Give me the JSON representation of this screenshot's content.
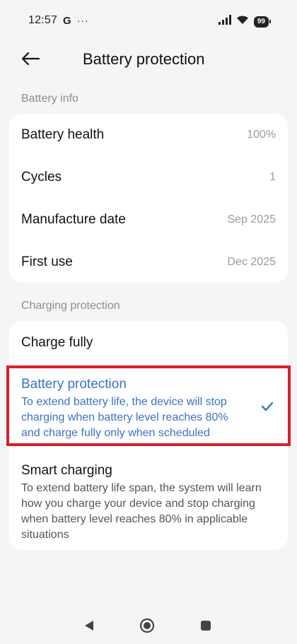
{
  "status_bar": {
    "time": "12:57",
    "google_indicator": "G",
    "more_notifications": "···",
    "battery_level": "99"
  },
  "header": {
    "title": "Battery protection"
  },
  "battery_info": {
    "section_label": "Battery info",
    "rows": [
      {
        "label": "Battery health",
        "value": "100%"
      },
      {
        "label": "Cycles",
        "value": "1"
      },
      {
        "label": "Manufacture date",
        "value": "Sep 2025"
      },
      {
        "label": "First use",
        "value": "Dec 2025"
      }
    ]
  },
  "charging_protection": {
    "section_label": "Charging protection",
    "options": [
      {
        "title": "Charge fully",
        "description": "",
        "selected": false
      },
      {
        "title": "Battery protection",
        "description": "To extend battery life, the device will stop charging when battery level reaches 80% and charge fully only when scheduled",
        "selected": true
      },
      {
        "title": "Smart charging",
        "description": "To extend battery life span, the system will learn how you charge your device and stop charging when battery level reaches 80% in applicable situations",
        "selected": false
      }
    ]
  },
  "colors": {
    "accent": "#3a73c1",
    "highlight": "#d81f2a",
    "background": "#f5f5f5",
    "card": "#ffffff"
  },
  "icons": {
    "back": "arrow-left-icon",
    "check": "checkmark-icon",
    "nav_back": "triangle-back-icon",
    "nav_home": "circle-home-icon",
    "nav_recents": "square-recents-icon"
  }
}
